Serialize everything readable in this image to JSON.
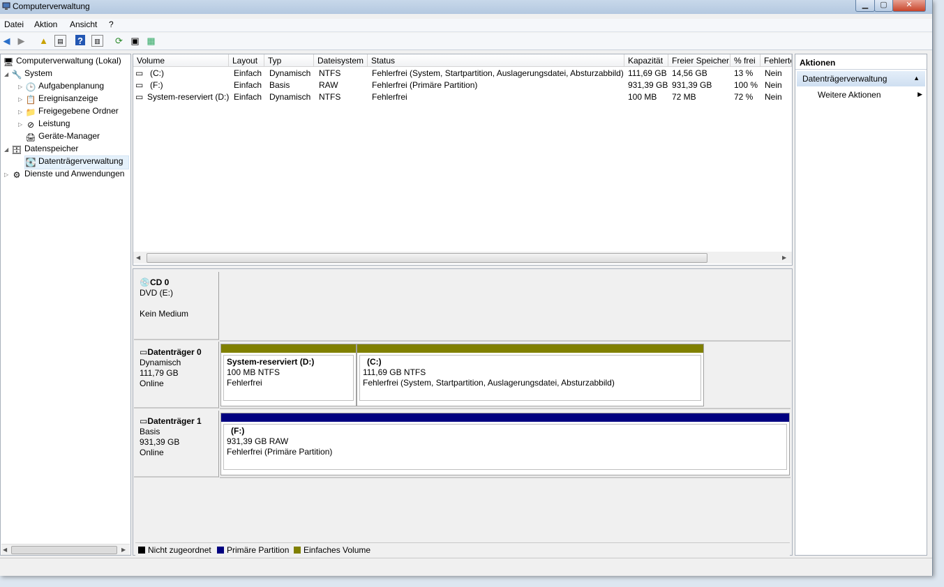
{
  "window": {
    "title": "Computerverwaltung"
  },
  "menu": [
    "Datei",
    "Aktion",
    "Ansicht",
    "?"
  ],
  "tree": {
    "root": "Computerverwaltung (Lokal)",
    "system": "System",
    "aufgaben": "Aufgabenplanung",
    "ereignis": "Ereignisanzeige",
    "freigabe": "Freigegebene Ordner",
    "leistung": "Leistung",
    "geraete": "Geräte-Manager",
    "datenspeicher": "Datenspeicher",
    "datentraeger": "Datenträgerverwaltung",
    "dienste": "Dienste und Anwendungen"
  },
  "volumes": {
    "headers": [
      "Volume",
      "Layout",
      "Typ",
      "Dateisystem",
      "Status",
      "Kapazität",
      "Freier Speicher",
      "% frei",
      "Fehlerto"
    ],
    "rows": [
      [
        "(C:)",
        "Einfach",
        "Dynamisch",
        "NTFS",
        "Fehlerfrei (System, Startpartition, Auslagerungsdatei, Absturzabbild)",
        "111,69 GB",
        "14,56 GB",
        "13 %",
        "Nein"
      ],
      [
        "(F:)",
        "Einfach",
        "Basis",
        "RAW",
        "Fehlerfrei (Primäre Partition)",
        "931,39 GB",
        "931,39 GB",
        "100 %",
        "Nein"
      ],
      [
        "System-reserviert (D:)",
        "Einfach",
        "Dynamisch",
        "NTFS",
        "Fehlerfrei",
        "100 MB",
        "72 MB",
        "72 %",
        "Nein"
      ]
    ]
  },
  "disks": {
    "cd0": {
      "name": "CD 0",
      "type": "DVD (E:)",
      "status": "Kein Medium"
    },
    "disk0": {
      "name": "Datenträger 0",
      "type": "Dynamisch",
      "size": "111,79 GB",
      "state": "Online",
      "p1": {
        "name": "System-reserviert  (D:)",
        "size": "100 MB NTFS",
        "status": "Fehlerfrei"
      },
      "p2": {
        "name": "(C:)",
        "size": "111,69 GB NTFS",
        "status": "Fehlerfrei (System, Startpartition, Auslagerungsdatei, Absturzabbild)"
      }
    },
    "disk1": {
      "name": "Datenträger 1",
      "type": "Basis",
      "size": "931,39 GB",
      "state": "Online",
      "p1": {
        "name": "(F:)",
        "size": "931,39 GB RAW",
        "status": "Fehlerfrei (Primäre Partition)"
      }
    }
  },
  "legend": {
    "unallocated": "Nicht zugeordnet",
    "primary": "Primäre Partition",
    "simple": "Einfaches Volume"
  },
  "actions": {
    "title": "Aktionen",
    "section": "Datenträgerverwaltung",
    "more": "Weitere Aktionen"
  },
  "colors": {
    "simple": "#808000",
    "primary": "#000080",
    "unallocated": "#000000"
  }
}
